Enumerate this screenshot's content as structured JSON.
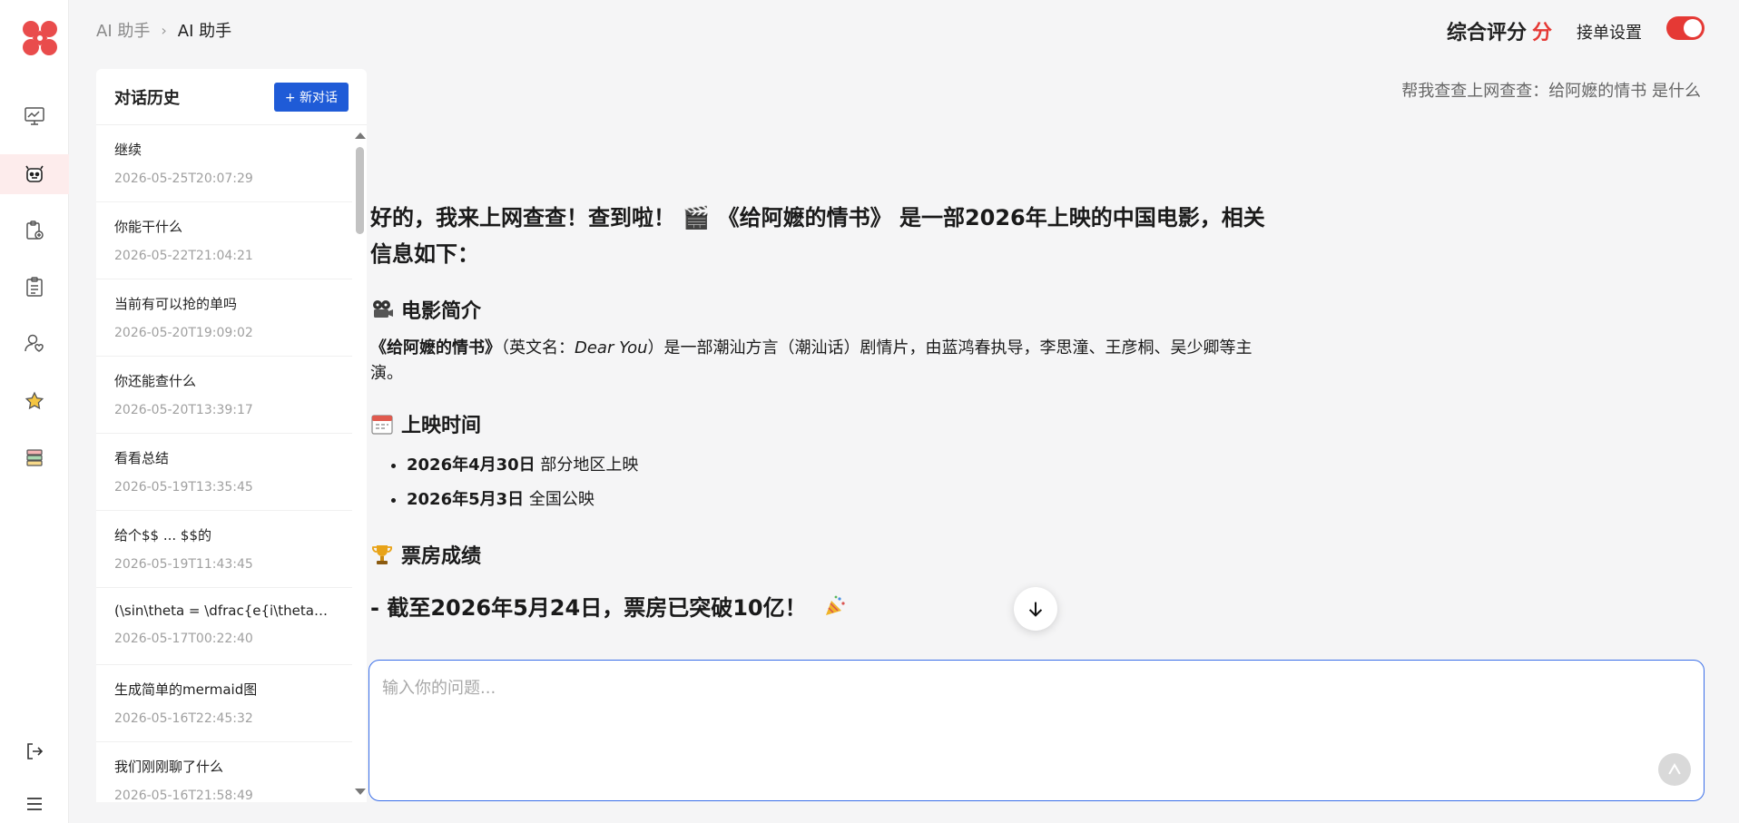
{
  "breadcrumb": {
    "parent": "AI 助手",
    "current": "AI 助手"
  },
  "header": {
    "score_label": "综合评分",
    "score_unit": "分",
    "order_setting": "接单设置",
    "accent": "#e53935"
  },
  "sidebar": {
    "items": [
      {
        "icon": "monitor-chart-icon"
      },
      {
        "icon": "robot-icon"
      },
      {
        "icon": "clipboard-add-icon"
      },
      {
        "icon": "clipboard-list-icon"
      },
      {
        "icon": "user-heart-icon"
      },
      {
        "icon": "star-icon"
      },
      {
        "icon": "books-icon"
      }
    ],
    "bottom": [
      {
        "icon": "logout-icon"
      },
      {
        "icon": "menu-icon"
      }
    ]
  },
  "history": {
    "title": "对话历史",
    "new_chat": "+ 新对话",
    "items": [
      {
        "title": "继续",
        "date": "2026-05-25T20:07:29"
      },
      {
        "title": "你能干什么",
        "date": "2026-05-22T21:04:21"
      },
      {
        "title": "当前有可以抢的单吗",
        "date": "2026-05-20T19:09:02"
      },
      {
        "title": "你还能查什么",
        "date": "2026-05-20T13:39:17"
      },
      {
        "title": "看看总结",
        "date": "2026-05-19T13:35:45"
      },
      {
        "title": "给个$$ ... $$的",
        "date": "2026-05-19T11:43:45"
      },
      {
        "title": "(\\sin\\theta = \\dfrac{e{i\\theta}...",
        "date": "2026-05-17T00:22:40"
      },
      {
        "title": "生成简单的mermaid图",
        "date": "2026-05-16T22:45:32"
      },
      {
        "title": "我们刚刚聊了什么",
        "date": "2026-05-16T21:58:49"
      }
    ]
  },
  "chat": {
    "user_message": "帮我查查上网查查：给阿嬷的情书 是什么",
    "answer": {
      "lead": "好的，我来上网查查！查到啦！ 🎬 《给阿嬷的情书》 是一部2026年上映的中国电影，相关信息如下：",
      "section1_title": "电影简介",
      "intro_bold": "《给阿嬷的情书》",
      "intro_pre": "（英文名：",
      "intro_en": "Dear You",
      "intro_post": "）是一部潮汕方言（潮汕话）剧情片，由蓝鸿春执导，李思潼、王彦桐、吴少卿等主演。",
      "section2_title": "上映时间",
      "release": [
        {
          "date": "2026年4月30日",
          "text": " 部分地区上映"
        },
        {
          "date": "2026年5月3日",
          "text": " 全国公映"
        }
      ],
      "section3_title": "票房成绩",
      "box_office": "- 截至2026年5月24日，票房已突破10亿！"
    }
  },
  "input": {
    "placeholder": "输入你的问题..."
  }
}
